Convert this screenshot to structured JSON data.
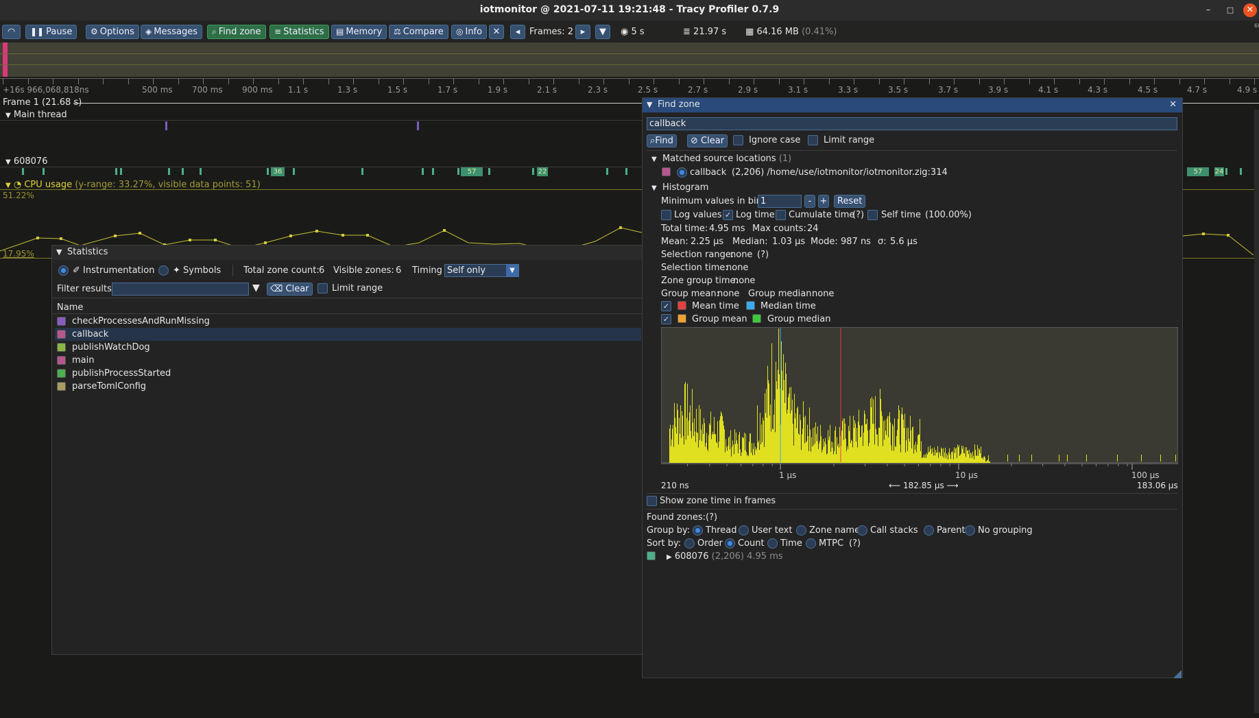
{
  "window": {
    "title": "iotmonitor @ 2021-07-11 19:21:48 - Tracy Profiler 0.7.9",
    "minimize": "–",
    "maximize": "□",
    "close": "✕"
  },
  "toolbar": {
    "pause": "Pause",
    "options": "Options",
    "messages": "Messages",
    "find_zone": "Find zone",
    "statistics": "Statistics",
    "memory": "Memory",
    "compare": "Compare",
    "info": "Info",
    "frames": "Frames: 2",
    "view_time": "5 s",
    "total_time": "21.97 s",
    "memory_usage": "64.16 MB",
    "memory_percent": "(0.41%)",
    "corner": "60"
  },
  "timeline": {
    "start": "+16s 966,068,818ns",
    "ticks": [
      "500 ms",
      "700 ms",
      "900 ms",
      "1.1 s",
      "1.3 s",
      "1.5 s",
      "1.7 s",
      "1.9 s",
      "2.1 s",
      "2.3 s",
      "2.5 s",
      "2.7 s",
      "2.9 s",
      "3.1 s",
      "3.3 s",
      "3.5 s",
      "3.7 s",
      "3.9 s",
      "4.1 s",
      "4.3 s",
      "4.5 s",
      "4.7 s",
      "4.9 s"
    ],
    "frame_label": "Frame 1 (21.68 s)",
    "main_thread": "Main thread",
    "thread_id": "608076",
    "zone_labels": [
      "36",
      "57",
      "22",
      "57",
      "24"
    ],
    "cpu_usage": "CPU usage",
    "cpu_info": "(y-range: 33.27%, visible data points: 51)",
    "cpu_max": "51.22%",
    "cpu_min": "17.95%"
  },
  "statistics": {
    "title": "Statistics",
    "mode_instrumentation": "Instrumentation",
    "mode_symbols": "Symbols",
    "total_zone_label": "Total zone count:",
    "total_zone_value": "6",
    "visible_zones_label": "Visible zones:",
    "visible_zones_value": "6",
    "timing_label": "Timing",
    "timing_value": "Self only",
    "filter_label": "Filter results",
    "filter_value": "",
    "clear": "Clear",
    "limit_range": "Limit range",
    "column_name": "Name",
    "rows": [
      {
        "name": "checkProcessesAndRunMissing",
        "color": "#8a5cc2"
      },
      {
        "name": "callback",
        "color": "#b5578e"
      },
      {
        "name": "publishWatchDog",
        "color": "#8ab548"
      },
      {
        "name": "main",
        "color": "#b5578e"
      },
      {
        "name": "publishProcessStarted",
        "color": "#4caf50"
      },
      {
        "name": "parseTomlConfig",
        "color": "#a89c62"
      }
    ]
  },
  "find_zone": {
    "title": "Find zone",
    "query": "callback",
    "find": "Find",
    "clear": "Clear",
    "ignore_case": "Ignore case",
    "limit_range": "Limit range",
    "matched_title": "Matched source locations",
    "matched_count": "(1)",
    "match_name": "callback",
    "match_info": "(2,206) /home/use/iotmonitor/iotmonitor.zig:314",
    "histogram_title": "Histogram",
    "min_values_label": "Minimum values in bin:",
    "min_values": "1",
    "minus": "-",
    "plus": "+",
    "reset": "Reset",
    "log_values": "Log values",
    "log_time": "Log time",
    "cumulate_time": "Cumulate time",
    "help": "(?)",
    "self_time": "Self time",
    "self_time_pct": "(100.00%)",
    "total_time_label": "Total time:",
    "total_time": "4.95 ms",
    "max_counts_label": "Max counts:",
    "max_counts": "24",
    "mean_label": "Mean:",
    "mean": "2.25 μs",
    "median_label": "Median:",
    "median": "1.03 μs",
    "mode_label": "Mode:",
    "mode": "987 ns",
    "sigma_label": "σ:",
    "sigma": "5.6 μs",
    "selection_range_label": "Selection range:",
    "selection_range": "none",
    "selection_time_label": "Selection time:",
    "selection_time": "none",
    "zone_group_time_label": "Zone group time:",
    "zone_group_time": "none",
    "group_mean_label": "Group mean:",
    "group_mean": "none",
    "group_median_label": "Group median:",
    "group_median": "none",
    "legend_mean": "Mean time",
    "legend_median": "Median time",
    "legend_group_mean": "Group mean",
    "legend_group_median": "Group median",
    "axis_labels": [
      "1 μs",
      "10 μs",
      "100 μs"
    ],
    "range_min": "210 ns",
    "range_width": "182.85 μs",
    "range_max": "183.06 μs",
    "show_zone_time": "Show zone time in frames",
    "found_zones": "Found zones:",
    "group_by": "Group by:",
    "group_options": [
      "Thread",
      "User text",
      "Zone name",
      "Call stacks",
      "Parent",
      "No grouping"
    ],
    "sort_by": "Sort by:",
    "sort_options": [
      "Order",
      "Count",
      "Time",
      "MTPC"
    ],
    "result_thread": "608076",
    "result_info": "(2,206) 4.95 ms",
    "colors": {
      "mean": "#e84040",
      "median": "#3da9f0",
      "group_mean": "#f0a030",
      "group_median": "#3cc93c",
      "bars": "#e0e020"
    }
  }
}
